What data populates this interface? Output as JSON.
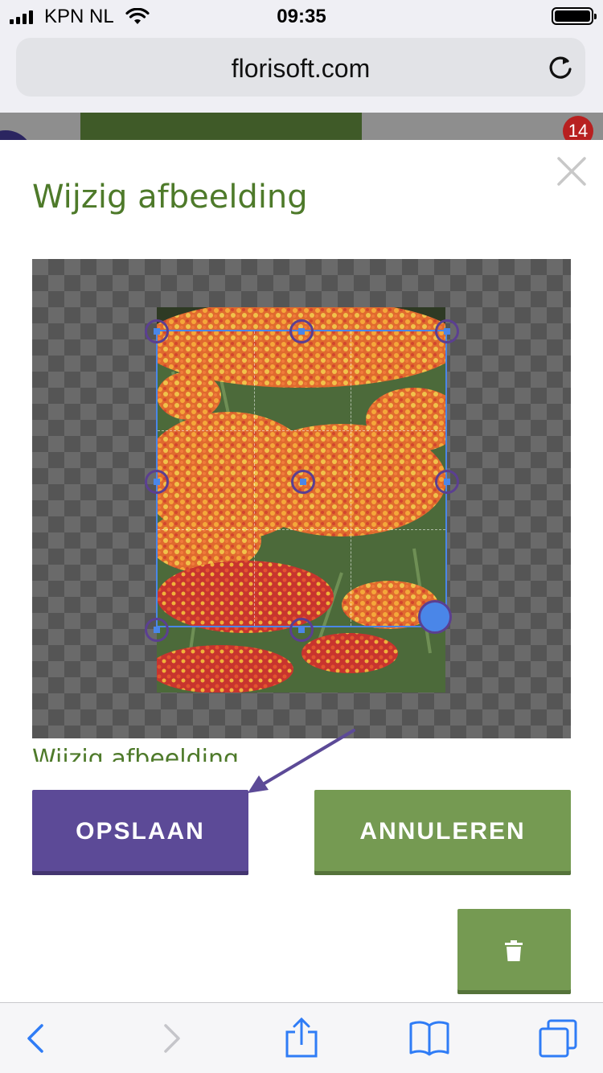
{
  "status_bar": {
    "carrier": "KPN NL",
    "time": "09:35",
    "battery_icon": "battery-full-icon",
    "signal_icon": "signal-bars-icon",
    "wifi_icon": "wifi-icon"
  },
  "browser": {
    "url": "florisoft.com",
    "reload_icon": "reload-icon",
    "notification_count": "14"
  },
  "modal": {
    "title": "Wijzig afbeelding",
    "subtitle": "Wijzig afbeelding",
    "close_icon": "close-icon",
    "save_label": "OPSLAAN",
    "cancel_label": "ANNULEREN",
    "delete_icon": "trash-icon"
  },
  "toolbar": {
    "back_icon": "chevron-left-icon",
    "forward_icon": "chevron-right-icon",
    "share_icon": "share-icon",
    "bookmarks_icon": "book-icon",
    "tabs_icon": "tabs-icon"
  },
  "colors": {
    "accent_purple": "#5c4a97",
    "accent_green": "#759a52",
    "title_green": "#4e7a2a",
    "crop_blue": "#4a86e8"
  }
}
